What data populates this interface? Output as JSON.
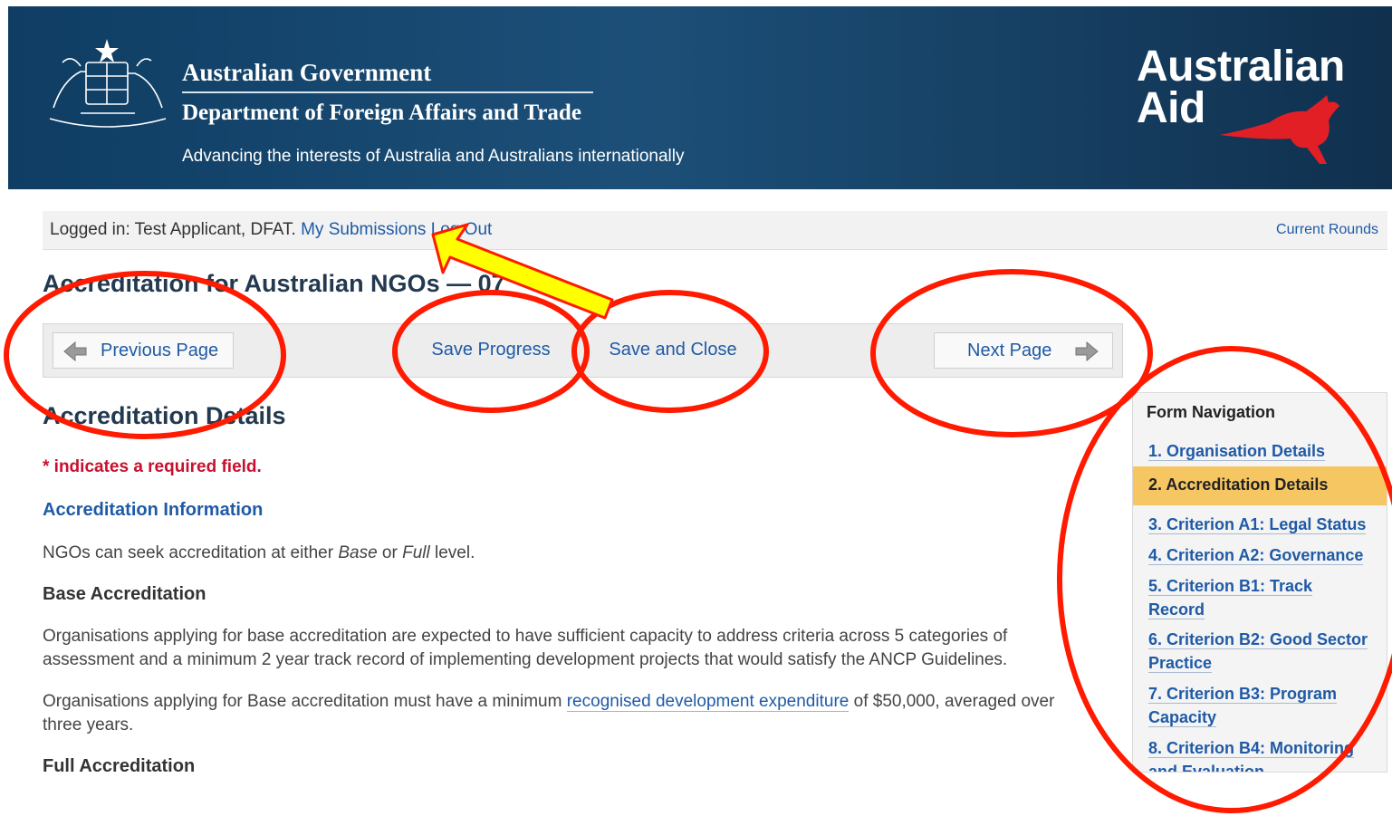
{
  "header": {
    "gov_title": "Australian Government",
    "dept_title": "Department of Foreign Affairs and Trade",
    "tagline": "Advancing the interests of Australia and Australians internationally",
    "aid_logo_line1": "Australian",
    "aid_logo_line2": "Aid",
    "brand_color": "#0f3d63",
    "kangaroo_color": "#e31f26"
  },
  "login_bar": {
    "logged_in_text": "Logged in: Test Applicant, DFAT.",
    "my_submissions": "My Submissions",
    "log_out": "Log Out",
    "current_rounds": "Current Rounds"
  },
  "page_title": "Accreditation for Australian NGOs — 07",
  "nav_buttons": {
    "previous": "Previous Page",
    "save_progress": "Save Progress",
    "save_close": "Save and Close",
    "next": "Next Page"
  },
  "content": {
    "section_title": "Accreditation Details",
    "required_note": "* indicates a required field.",
    "info_heading": "Accreditation Information",
    "intro_prefix": "NGOs can seek accreditation at either ",
    "intro_base": "Base",
    "intro_mid": " or ",
    "intro_full": "Full",
    "intro_suffix": " level.",
    "base_heading": "Base Accreditation",
    "base_para1_line1": "Organisations applying for base accreditation are expected to have sufficient capacity to address criteria across 5 categories of",
    "base_para1_line2": "assessment and a minimum 2 year track record of implementing development projects that would satisfy the ANCP Guidelines.",
    "base_para2_prefix": "Organisations applying for Base accreditation must have a minimum ",
    "base_para2_link": "recognised development expenditure",
    "base_para2_suffix": " of $50,000, averaged over",
    "base_para2_line2": "three years.",
    "full_heading": "Full Accreditation"
  },
  "form_nav": {
    "title": "Form Navigation",
    "items": [
      "1. Organisation Details",
      "2. Accreditation Details",
      "3. Criterion A1: Legal Status",
      "4. Criterion A2: Governance",
      "5. Criterion B1: Track",
      "Record",
      "6. Criterion B2: Good Sector",
      "Practice",
      "7. Criterion B3: Program",
      "Capacity",
      "8. Criterion B4: Monitoring",
      "and Evaluation"
    ],
    "active_color": "#f6c663"
  },
  "annotations": {
    "circle_color": "#ff1a00",
    "arrow_color": "#ffff00"
  }
}
